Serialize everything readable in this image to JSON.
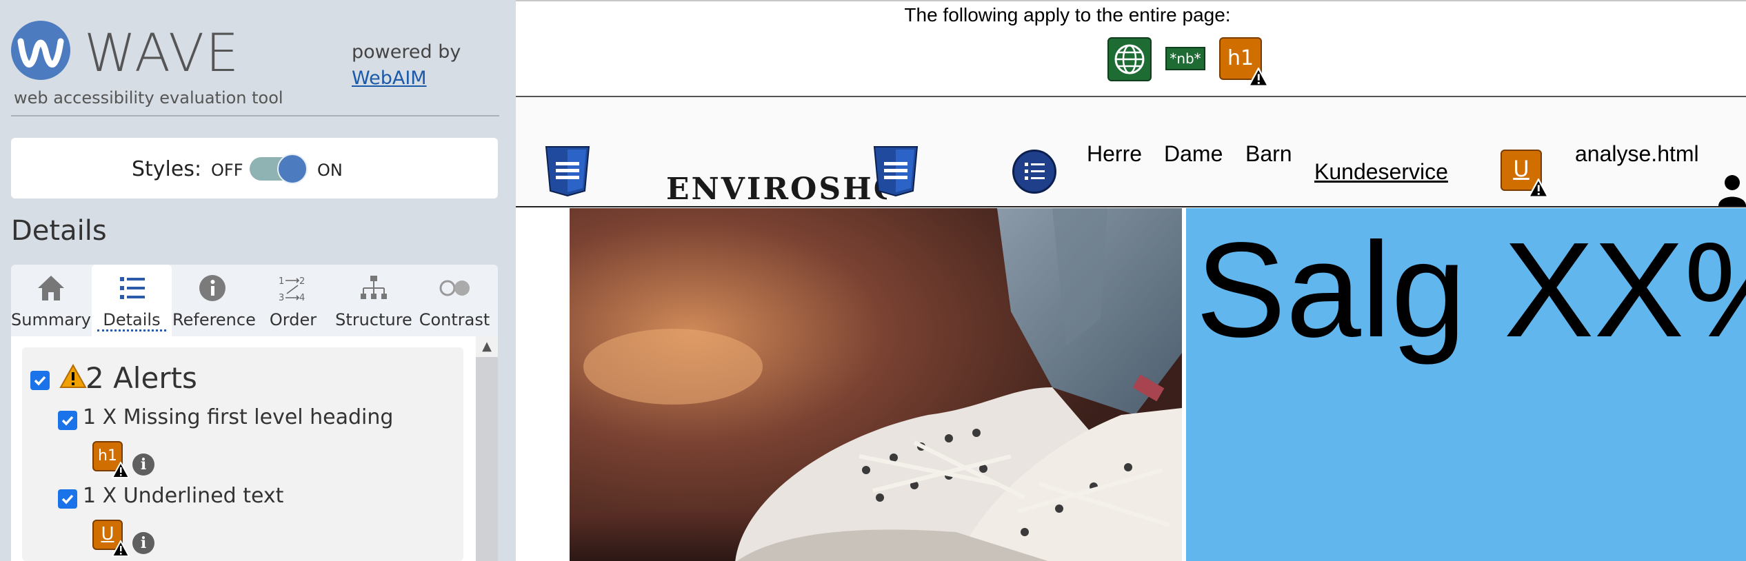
{
  "wave": {
    "logo_text": "WAVE",
    "tagline": "web accessibility evaluation tool",
    "powered_by": "powered by",
    "webaim_link": "WebAIM",
    "styles_label": "Styles:",
    "styles_off": "OFF",
    "styles_on": "ON",
    "styles_state": "ON",
    "details_heading": "Details",
    "tabs": [
      {
        "label": "Summary",
        "icon": "home-icon"
      },
      {
        "label": "Details",
        "icon": "list-icon",
        "active": true
      },
      {
        "label": "Reference",
        "icon": "info-icon"
      },
      {
        "label": "Order",
        "icon": "order-icon"
      },
      {
        "label": "Structure",
        "icon": "structure-icon"
      },
      {
        "label": "Contrast",
        "icon": "contrast-icon"
      }
    ],
    "alerts": {
      "title": "2 Alerts",
      "items": [
        {
          "label": "1 X Missing first level heading",
          "icon_text": "h1",
          "icon": "missing-h1-alert-icon"
        },
        {
          "label": "1 X Underlined text",
          "icon_text": "U",
          "icon": "underline-alert-icon"
        }
      ]
    },
    "colors": {
      "accent": "#4c7cbf",
      "sidebar_bg": "#d7dde4",
      "alert_orange": "#d06f00",
      "checkbox": "#1a73e8"
    }
  },
  "page": {
    "notice": "The following apply to the entire page:",
    "notice_icons": [
      {
        "icon": "language-globe-icon"
      },
      {
        "icon": "nb-icon",
        "text": "*nb*"
      },
      {
        "icon": "missing-h1-alert-icon",
        "text": "h1"
      }
    ],
    "brand": "ENVIROSHOP",
    "nav": {
      "herre": "Herre",
      "dame": "Dame",
      "barn": "Barn",
      "kundeservice": "Kundeservice",
      "analyse": "analyse.html"
    },
    "underline_icon_text": "U",
    "sale_text": "Salg XX%",
    "colors": {
      "sale_bg": "#62b6ee",
      "css_badge": "#1f4a9e"
    }
  }
}
